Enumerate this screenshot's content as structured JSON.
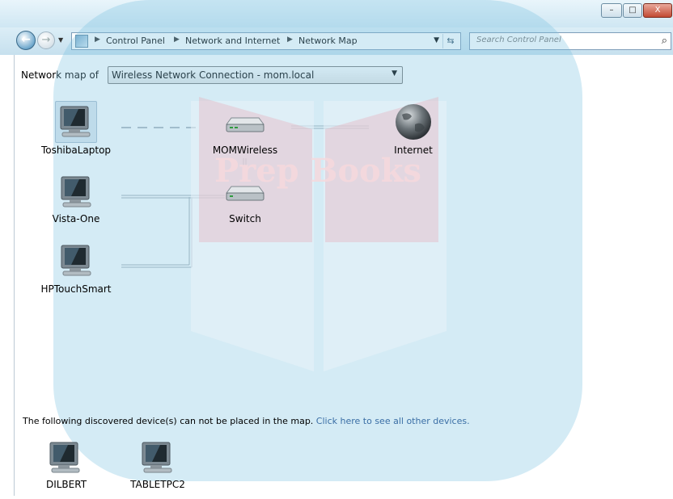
{
  "window": {
    "buttons": {
      "minimize": "–",
      "maximize": "□",
      "close": "X"
    }
  },
  "nav": {
    "back_glyph": "←",
    "forward_glyph": "→",
    "breadcrumbs": [
      "Control Panel",
      "Network and Internet",
      "Network Map"
    ],
    "search_placeholder": "Search Control Panel"
  },
  "map": {
    "label": "Network map of",
    "selected_connection": "Wireless Network Connection - mom.local",
    "nodes": {
      "toshiba": "ToshibaLaptop",
      "momwireless": "MOMWireless",
      "internet": "Internet",
      "vista": "Vista-One",
      "switch": "Switch",
      "hptouch": "HPTouchSmart"
    }
  },
  "undiscovered": {
    "message": "The following discovered device(s) can not be placed in the map.",
    "link": "Click here to see all other devices.",
    "devices": [
      "DILBERT",
      "TABLETPC2"
    ]
  },
  "watermark": {
    "text": "Prep Books"
  }
}
